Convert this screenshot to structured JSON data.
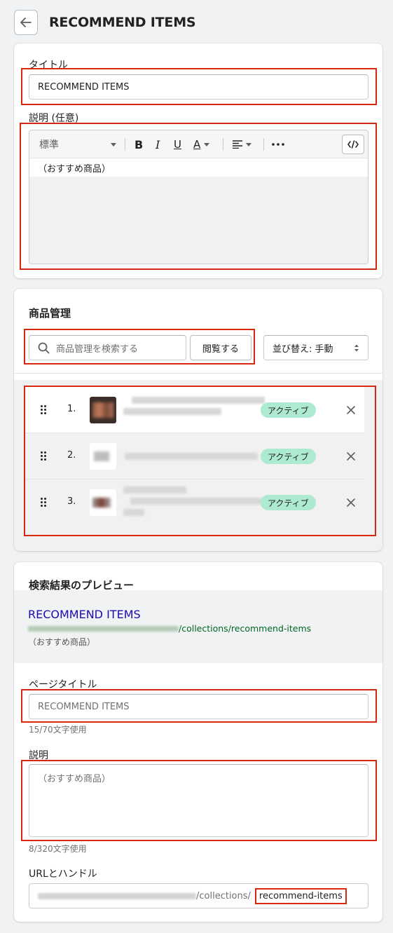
{
  "header": {
    "title": "RECOMMEND ITEMS"
  },
  "title_card": {
    "title_label": "タイトル",
    "title_value": "RECOMMEND ITEMS",
    "desc_label": "説明 (任意)",
    "toolbar": {
      "format_label": "標準",
      "bold": "B",
      "italic": "I",
      "underline": "U",
      "color": "A"
    },
    "editor_text": "（おすすめ商品）"
  },
  "products_card": {
    "heading": "商品管理",
    "search_placeholder": "商品管理を検索する",
    "browse_label": "閲覧する",
    "sort_label": "並び替え: 手動",
    "items": [
      {
        "index": "1.",
        "status": "アクティブ"
      },
      {
        "index": "2.",
        "status": "アクティブ"
      },
      {
        "index": "3.",
        "status": "アクティブ"
      }
    ]
  },
  "seo_card": {
    "heading": "検索結果のプレビュー",
    "preview_title": "RECOMMEND ITEMS",
    "preview_url_path": "/collections/recommend-items",
    "preview_desc": "（おすすめ商品）",
    "page_title_label": "ページタイトル",
    "page_title_placeholder": "RECOMMEND ITEMS",
    "page_title_count": "15/70文字使用",
    "desc_label": "説明",
    "desc_placeholder": "（おすすめ商品）",
    "desc_count": "8/320文字使用",
    "url_label": "URLとハンドル",
    "url_prefix": "/collections/",
    "handle": "recommend-items"
  }
}
